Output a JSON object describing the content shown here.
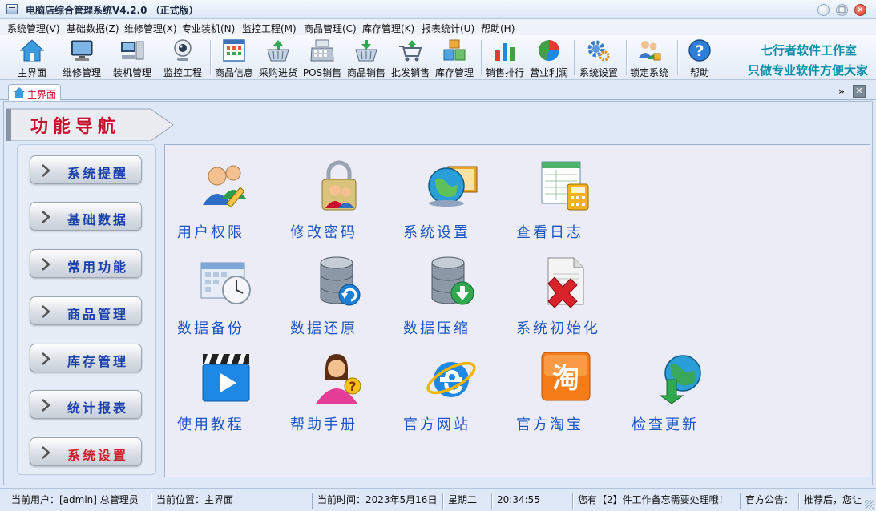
{
  "window": {
    "title": "电脑店综合管理系统V4.2.0 （正式版）",
    "min_symbol": "–",
    "max_symbol": "□",
    "close_symbol": "×"
  },
  "menu": [
    "系统管理(V)",
    "基础数据(Z)",
    "维修管理(X)",
    "专业装机(N)",
    "监控工程(M)",
    "商品管理(C)",
    "库存管理(K)",
    "报表统计(U)",
    "帮助(H)"
  ],
  "toolbar": [
    {
      "label": "主界面",
      "icon": "home-icon"
    },
    {
      "label": "维修管理",
      "icon": "monitor-icon"
    },
    {
      "label": "装机管理",
      "icon": "computer-icon"
    },
    {
      "label": "监控工程",
      "icon": "webcam-icon"
    },
    {
      "label": "商品信息",
      "icon": "grid-calendar-icon"
    },
    {
      "label": "采购进货",
      "icon": "basket-in-icon"
    },
    {
      "label": "POS销售",
      "icon": "cash-register-icon"
    },
    {
      "label": "商品销售",
      "icon": "basket-out-icon"
    },
    {
      "label": "批发销售",
      "icon": "cart-icon"
    },
    {
      "label": "库存管理",
      "icon": "boxes-icon"
    },
    {
      "label": "销售排行",
      "icon": "bar-chart-icon"
    },
    {
      "label": "营业利润",
      "icon": "pie-chart-icon"
    },
    {
      "label": "系统设置",
      "icon": "gear-icon"
    },
    {
      "label": "锁定系统",
      "icon": "users-lock-icon"
    },
    {
      "label": "帮助",
      "icon": "help-icon"
    }
  ],
  "brand": {
    "line1": "七行者软件工作室",
    "line2": "只做专业软件方便大家"
  },
  "tabs": {
    "home": "主界面",
    "more_symbol": "»",
    "close_symbol": "✕"
  },
  "nav": {
    "title": "功能导航",
    "items": [
      "系统提醒",
      "基础数据",
      "常用功能",
      "商品管理",
      "库存管理",
      "统计报表",
      "系统设置"
    ],
    "active_index": 6
  },
  "functions": [
    {
      "label": "用户权限",
      "icon": "users-edit-icon"
    },
    {
      "label": "修改密码",
      "icon": "password-lock-icon"
    },
    {
      "label": "系统设置",
      "icon": "globe-monitor-icon"
    },
    {
      "label": "查看日志",
      "icon": "log-calculator-icon"
    },
    {
      "label": "数据备份",
      "icon": "backup-calendar-icon"
    },
    {
      "label": "数据还原",
      "icon": "database-restore-icon"
    },
    {
      "label": "数据压缩",
      "icon": "database-compress-icon"
    },
    {
      "label": "系统初始化",
      "icon": "document-delete-icon"
    },
    {
      "label": "使用教程",
      "icon": "video-tutorial-icon"
    },
    {
      "label": "帮助手册",
      "icon": "help-person-icon"
    },
    {
      "label": "官方网站",
      "icon": "internet-explorer-icon"
    },
    {
      "label": "官方淘宝",
      "icon": "taobao-icon"
    },
    {
      "label": "检查更新",
      "icon": "globe-update-icon"
    }
  ],
  "status": {
    "user": "当前用户：[admin] 总管理员",
    "location": "当前位置：主界面",
    "date": "当前时间：2023年5月16日",
    "weekday": "星期二",
    "time": "20:34:55",
    "todo": "您有【2】件工作备忘需要处理哦！",
    "notice_label": "官方公告：",
    "notice_text": "推荐后，您让"
  },
  "colors": {
    "accent_red": "#c8102e",
    "nav_blue": "#1a3fae",
    "func_blue": "#1b55c4",
    "brand_teal": "#0b8fa8",
    "background": "#dfe8f6"
  }
}
